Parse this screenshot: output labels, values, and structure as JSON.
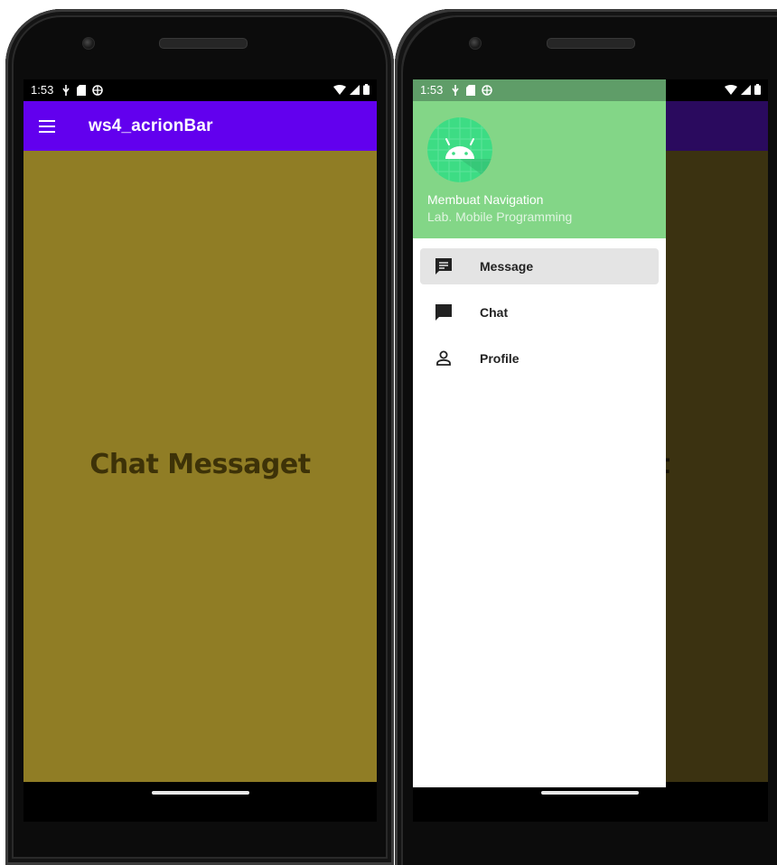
{
  "left_screen": {
    "status": {
      "time": "1:53",
      "icons_left": [
        "usb-icon",
        "sd-card-icon",
        "globe-icon"
      ],
      "icons_right": [
        "wifi-icon",
        "signal-icon",
        "battery-icon"
      ]
    },
    "appbar": {
      "menu_icon": "hamburger-menu-icon",
      "title": "ws4_acrionBar",
      "color": "#6200ee"
    },
    "content": {
      "text": "Chat Messaget",
      "background": "#907d25"
    }
  },
  "right_screen": {
    "status": {
      "time": "1:53",
      "icons_left": [
        "usb-icon",
        "sd-card-icon",
        "globe-icon"
      ],
      "icons_right": [
        "wifi-icon",
        "signal-icon",
        "battery-icon"
      ]
    },
    "drawer": {
      "header": {
        "avatar_icon": "android-icon",
        "title": "Membuat Navigation",
        "subtitle": "Lab. Mobile Programming",
        "color": "#83d687"
      },
      "items": [
        {
          "label": "Message",
          "icon": "message-icon",
          "selected": true
        },
        {
          "label": "Chat",
          "icon": "chat-icon",
          "selected": false
        },
        {
          "label": "Profile",
          "icon": "profile-icon",
          "selected": false
        }
      ]
    },
    "background_text_fragment": "et"
  }
}
